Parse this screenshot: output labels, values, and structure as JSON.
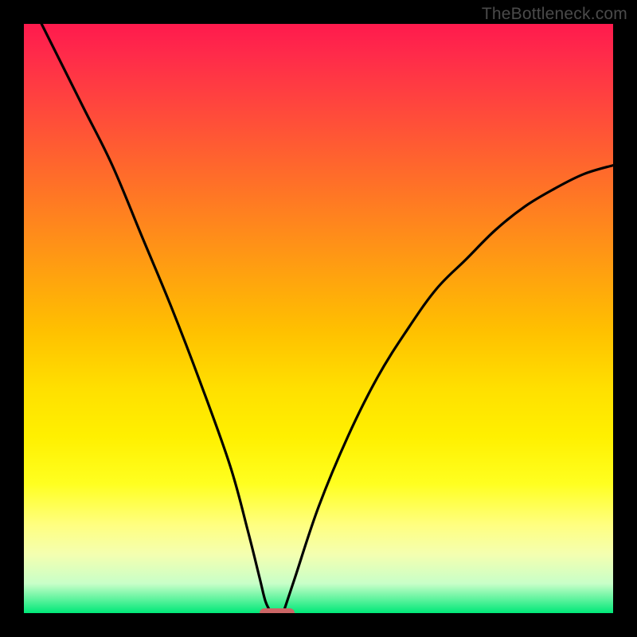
{
  "watermark": "TheBottleneck.com",
  "chart_data": {
    "type": "line",
    "title": "",
    "xlabel": "",
    "ylabel": "",
    "xlim": [
      0,
      100
    ],
    "ylim": [
      0,
      100
    ],
    "grid": false,
    "legend": false,
    "series": [
      {
        "name": "left-curve",
        "x": [
          3,
          10,
          15,
          20,
          25,
          30,
          35,
          38,
          40,
          41,
          42
        ],
        "values": [
          100,
          86,
          76,
          64,
          52,
          39,
          25,
          14,
          6,
          2,
          0
        ]
      },
      {
        "name": "right-curve",
        "x": [
          44,
          46,
          50,
          55,
          60,
          65,
          70,
          75,
          80,
          85,
          90,
          95,
          100
        ],
        "values": [
          0,
          6,
          18,
          30,
          40,
          48,
          55,
          60,
          65,
          69,
          72,
          74.5,
          76
        ]
      }
    ],
    "marker": {
      "x": 43,
      "y": 0,
      "color": "#cc6666"
    },
    "background_gradient": {
      "top": "#ff1a4d",
      "mid": "#ffe000",
      "bottom": "#00e878"
    }
  }
}
